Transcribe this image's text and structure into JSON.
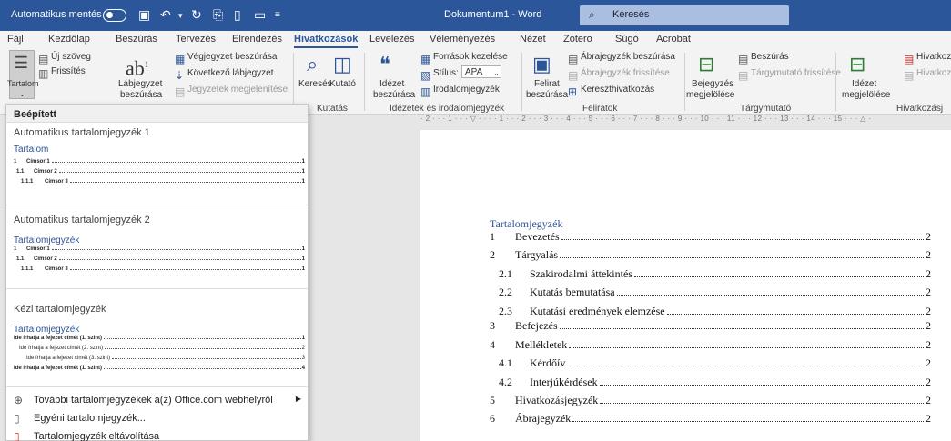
{
  "titlebar": {
    "autosave": "Automatikus mentés",
    "doc_title": "Dokumentum1 - Word",
    "search_label": "Keresés"
  },
  "menu": [
    "Fájl",
    "Kezdőlap",
    "Beszúrás",
    "Tervezés",
    "Elrendezés",
    "Hivatkozások",
    "Levelezés",
    "Véleményezés",
    "Nézet",
    "Zotero",
    "Súgó",
    "Acrobat"
  ],
  "ribbon": {
    "toc_label": "Tartalom",
    "update_text": "Új szöveg",
    "refresh": "Frissítés",
    "footnote": "Lábjegyzet",
    "footnote2": "beszúrása",
    "endnote": "Végjegyzet beszúrása",
    "next_footnote": "Következő lábjegyzet",
    "show_notes": "Jegyzetek megjelenítése",
    "search": "Keresés",
    "researcher": "Kutató",
    "group_kutatas": "Kutatás",
    "cite": "Idézet",
    "cite2": "beszúrása",
    "sources": "Források kezelése",
    "style": "Stílus:",
    "style_value": "APA",
    "bibliography": "Irodalomjegyzék",
    "group_cit": "Idézetek és irodalomjegyzék",
    "caption": "Felirat",
    "caption2": "beszúrása",
    "tof_insert": "Ábrajegyzék beszúrása",
    "tof_update": "Ábrajegyzék frissítése",
    "crossref": "Kereszthivatkozás",
    "group_feliratok": "Feliratok",
    "mark_entry": "Bejegyzés",
    "mark_entry2": "megjelölése",
    "index_insert": "Beszúrás",
    "index_update": "Tárgymutató frissítése",
    "group_index": "Tárgymutató",
    "mark_cite": "Idézet",
    "mark_cite2": "megjelölése",
    "toa_insert": "Hivatkoz",
    "toa_update": "Hivatkoz",
    "group_toa": "Hivatkozásj"
  },
  "dropdown": {
    "builtin": "Beépített",
    "auto1": "Automatikus tartalomjegyzék 1",
    "auto1_title": "Tartalom",
    "auto2": "Automatikus tartalomjegyzék 2",
    "auto2_title": "Tartalomjegyzék",
    "manual": "Kézi tartalomjegyzék",
    "manual_title": "Tartalomjegyzék",
    "preview_auto": [
      {
        "num": "1",
        "text": "Címsor 1",
        "page": "1"
      },
      {
        "num": "1.1",
        "text": "Címsor 2",
        "page": "1"
      },
      {
        "num": "1.1.1",
        "text": "Címsor 3",
        "page": "1"
      }
    ],
    "preview_manual": [
      {
        "text": "Ide írhatja a fejezet címét (1. szint)",
        "page": "1"
      },
      {
        "text": "Ide írhatja a fejezet címét (2. szint)",
        "page": "2"
      },
      {
        "text": "Ide írhatja a fejezet címét (3. szint)",
        "page": "3"
      },
      {
        "text": "Ide írhatja a fejezet címét (1. szint)",
        "page": "4"
      }
    ],
    "more_online": "További tartalomjegyzékek a(z) Office.com webhelyről",
    "custom": "Egyéni tartalomjegyzék...",
    "remove": "Tartalomjegyzék eltávolítása"
  },
  "ruler": "· 2 · · · 1 · · · ▽ · · · · 1 · · · 2 · · · 3 · · · 4 · · · 5 · · · 6 · · · 7 · · · 8 · · · 9 · · · 10 · · · 11 · · · 12 · · · 13 · · · 14 · · · 15 · · · △ ·",
  "document": {
    "toc_title": "Tartalomjegyzék",
    "entries": [
      {
        "num": "1",
        "text": "Bevezetés",
        "page": "2",
        "level": 1
      },
      {
        "num": "2",
        "text": "Tárgyalás",
        "page": "2",
        "level": 1
      },
      {
        "num": "2.1",
        "text": "Szakirodalmi áttekintés",
        "page": "2",
        "level": 2
      },
      {
        "num": "2.2",
        "text": "Kutatás bemutatása",
        "page": "2",
        "level": 2
      },
      {
        "num": "2.3",
        "text": "Kutatási eredmények elemzése",
        "page": "2",
        "level": 2
      },
      {
        "num": "3",
        "text": "Befejezés",
        "page": "2",
        "level": 1
      },
      {
        "num": "4",
        "text": "Mellékletek",
        "page": "2",
        "level": 1
      },
      {
        "num": "4.1",
        "text": "Kérdőív",
        "page": "2",
        "level": 2
      },
      {
        "num": "4.2",
        "text": "Interjúkérdések",
        "page": "2",
        "level": 2
      },
      {
        "num": "5",
        "text": "Hivatkozásjegyzék",
        "page": "2",
        "level": 1
      },
      {
        "num": "6",
        "text": "Ábrajegyzék",
        "page": "2",
        "level": 1
      }
    ]
  }
}
